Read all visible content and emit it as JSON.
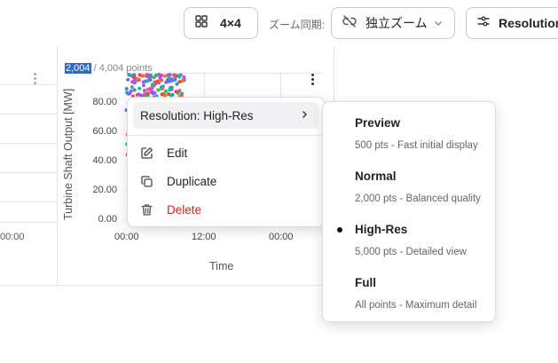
{
  "toolbar": {
    "grid_label": "4×4",
    "sync_label": "ズーム同期:",
    "sync_value": "独立ズーム",
    "resolution_label": "Resolution"
  },
  "left_panel": {
    "x_tick": "00:00"
  },
  "chart": {
    "points_shown": "2,004",
    "points_total": "/ 4,004 points",
    "y_axis_title": "Turbine Shaft Output [MW]",
    "y_ticks": [
      "80.00",
      "60.00",
      "40.00",
      "20.00",
      "0.00"
    ],
    "x_ticks": [
      "00:00",
      "12:00",
      "00:00"
    ],
    "x_axis_title": "Time"
  },
  "context_menu": {
    "resolution_item": "Resolution: High-Res",
    "edit": "Edit",
    "duplicate": "Duplicate",
    "delete": "Delete"
  },
  "resolution_menu": {
    "selected": "High-Res",
    "options": [
      {
        "title": "Preview",
        "desc": "500 pts - Fast initial display"
      },
      {
        "title": "Normal",
        "desc": "2,000 pts - Balanced quality"
      },
      {
        "title": "High-Res",
        "desc": "5,000 pts - Detailed view"
      },
      {
        "title": "Full",
        "desc": "All points - Maximum detail"
      }
    ]
  },
  "colors": {
    "accent": "#2f68c5",
    "danger": "#d0261e",
    "series": [
      "#a855f7",
      "#22c55e",
      "#ec4899",
      "#3b82f6",
      "#f97316",
      "#14b8a6",
      "#8b5cf6",
      "#ef4444"
    ]
  }
}
